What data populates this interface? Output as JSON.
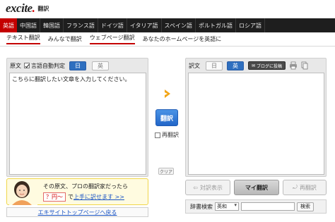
{
  "logo": {
    "wordmark_main": "excite",
    "wordmark_dot": ".",
    "sub": "翻訳"
  },
  "languages": [
    "英語",
    "中国語",
    "韓国語",
    "フランス語",
    "ドイツ語",
    "イタリア語",
    "スペイン語",
    "ポルトガル語",
    "ロシア語"
  ],
  "sub_nav": [
    "テキスト翻訳",
    "みんなで翻訳",
    "ウェブページ翻訳",
    "あなたのホームページを英語に"
  ],
  "source": {
    "label": "原文",
    "auto_detect_label": "言語自動判定",
    "auto_detect_checked": true,
    "lang_ja": "日",
    "lang_en": "英",
    "placeholder": "こちらに翻訳したい文章を入力してください。"
  },
  "target": {
    "label": "訳文",
    "lang_ja": "日",
    "lang_en": "英",
    "blog_button": "ブログに投稿"
  },
  "controls": {
    "translate_button": "翻訳",
    "retranslate_label": "再翻訳",
    "clear_button": "クリア"
  },
  "actions": {
    "compare": "対訳表示",
    "my_translation": "マイ翻訳",
    "retranslate": "再翻訳"
  },
  "promo": {
    "line1": "その原文、プロの翻訳家だったら",
    "price": "？円〜",
    "line2_middle": "で",
    "link": "上手に訳せます >>"
  },
  "back_link": "エキサイトトップページへ戻る",
  "dictionary": {
    "label": "辞書検索",
    "select_value": "英和",
    "button": "検索"
  },
  "colors": {
    "accent_red": "#c40000",
    "blue": "#2f6fbf",
    "nav_bg": "#1e1e1e"
  }
}
